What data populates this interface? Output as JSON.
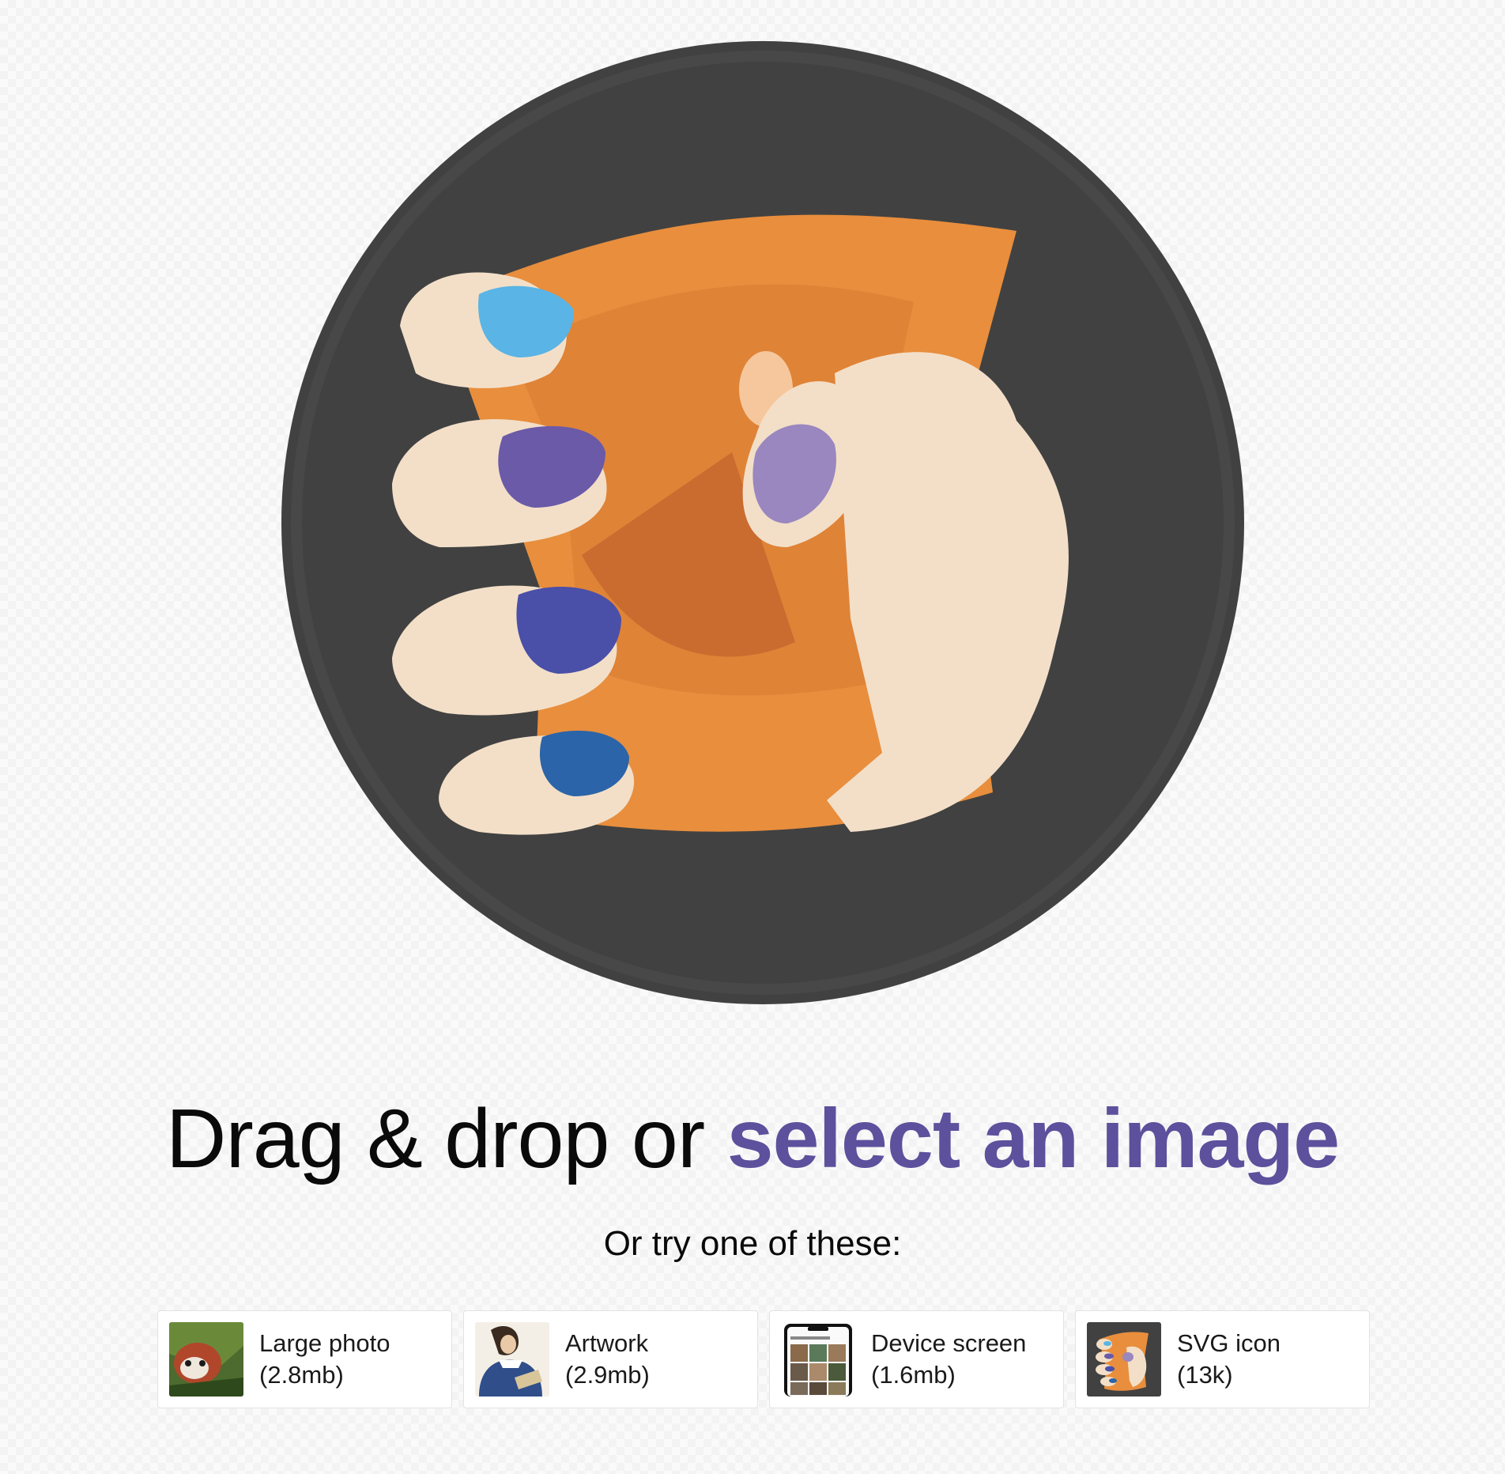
{
  "hero": {
    "icon": "squoosh-hand-logo-icon",
    "colors": {
      "circle": "#414141",
      "paper": "#e88e3d",
      "skin": "#f3dfc8",
      "nail_light_blue": "#5ab4e5",
      "nail_purple": "#6a5aa8",
      "nail_lilac": "#9a87bf",
      "nail_indigo": "#4a4fa8",
      "nail_blue": "#2b64a8"
    }
  },
  "headline": {
    "prefix": "Drag & drop or",
    "link": "select an image",
    "link_color": "#5d509c"
  },
  "subline": "Or try one of these:",
  "samples": [
    {
      "title": "Large photo",
      "size": "(2.8mb)",
      "thumb_icon": "red-panda-photo-icon"
    },
    {
      "title": "Artwork",
      "size": "(2.9mb)",
      "thumb_icon": "artwork-painting-icon"
    },
    {
      "title": "Device screen",
      "size": "(1.6mb)",
      "thumb_icon": "device-screen-icon"
    },
    {
      "title": "SVG icon",
      "size": "(13k)",
      "thumb_icon": "svg-hand-icon"
    }
  ]
}
